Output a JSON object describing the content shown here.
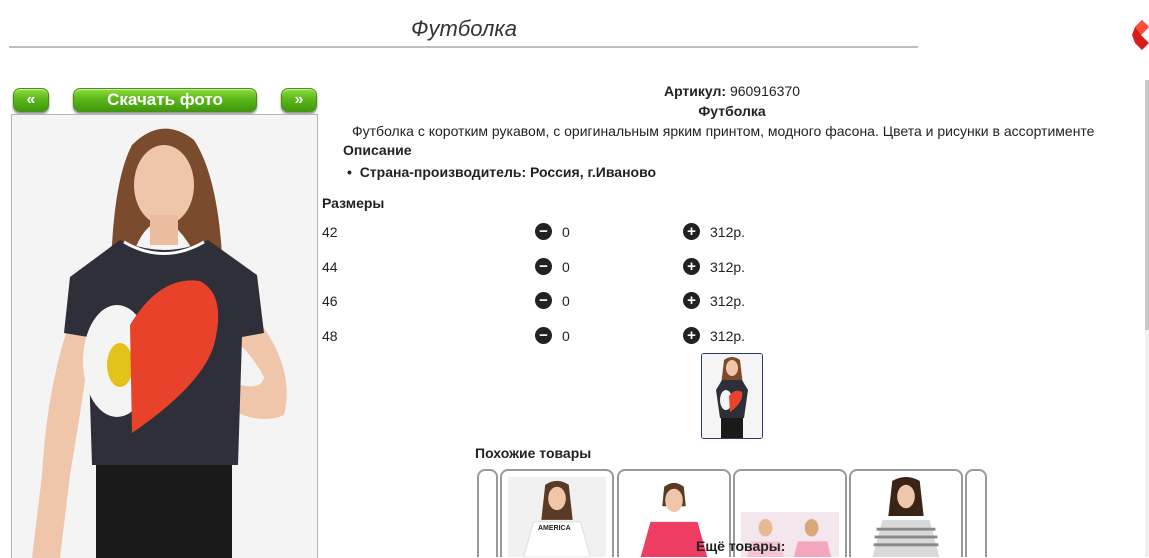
{
  "page": {
    "title": "Футболка"
  },
  "nav": {
    "prev_label": "«",
    "download_label": "Скачать фото",
    "next_label": "»"
  },
  "product": {
    "sku_label": "Артикул:",
    "sku_value": "960916370",
    "name": "Футболка",
    "description": "Футболка с коротким рукавом, с оригинальным ярким принтом, модного фасона. Цвета и рисунки в ассортименте",
    "description_heading": "Описание",
    "features": [
      "Страна-производитель: Россия, г.Иваново"
    ]
  },
  "sizes": {
    "heading": "Размеры",
    "rows": [
      {
        "size": "42",
        "qty": "0",
        "price": "312р."
      },
      {
        "size": "44",
        "qty": "0",
        "price": "312р."
      },
      {
        "size": "46",
        "qty": "0",
        "price": "312р."
      },
      {
        "size": "48",
        "qty": "0",
        "price": "312р."
      }
    ]
  },
  "similar": {
    "heading": "Похожие товары",
    "card_texts": [
      "AMERICA"
    ]
  },
  "more": {
    "heading": "Ещё товары:"
  },
  "colors": {
    "accent_green": "#5cb81a",
    "print_red": "#e8432a",
    "shirt_dark": "#2e2f38",
    "frame_blue": "#2b3b6f",
    "corner_red": "#d81b1b"
  }
}
